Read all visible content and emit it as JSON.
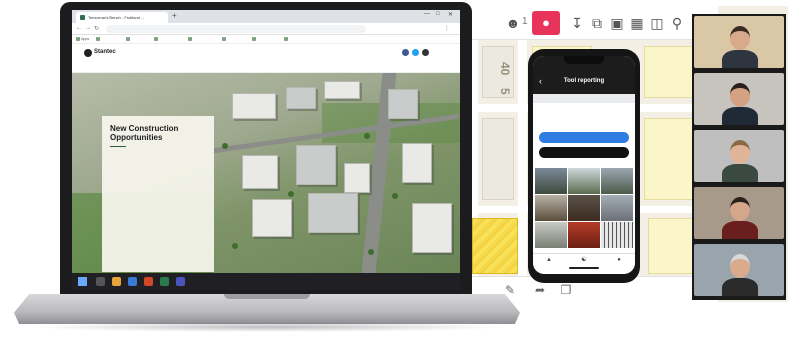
{
  "map_app": {
    "participant_count": "1",
    "record_icon": "record-icon",
    "toolbar_icons": [
      "download-icon",
      "layers-icon",
      "comment-icon",
      "table-icon",
      "panel-icon",
      "zoom-icon"
    ],
    "road_label_1": "40",
    "road_label_2": "5",
    "bottom_icons": [
      "pen-icon",
      "share-icon",
      "copy-icon"
    ]
  },
  "video_tiles": [
    {
      "name": "",
      "wall": "#d9c7a6",
      "skin": "#d8a98a",
      "hair": "#3a2a20",
      "shirt": "#2e3440"
    },
    {
      "name": "",
      "wall": "#c7c3bd",
      "skin": "#d4a283",
      "hair": "#2a1f1a",
      "shirt": "#1f2a36"
    },
    {
      "name": "",
      "wall": "#bfbfbf",
      "skin": "#e0b497",
      "hair": "#8a6a45",
      "shirt": "#3a4a40"
    },
    {
      "name": "",
      "wall": "#a89a8a",
      "skin": "#d6a68a",
      "hair": "#2b221c",
      "shirt": "#6a1e1e"
    },
    {
      "name": "",
      "wall": "#9aa4ad",
      "skin": "#d9ab8c",
      "hair": "#d8d8d8",
      "shirt": "#2b2b2b"
    }
  ],
  "browser": {
    "tab_title": "Tomorrow's Bench - Fruitland ...",
    "url": "",
    "bookmarks": [
      "Apps",
      "",
      "",
      "",
      "",
      "",
      "",
      ""
    ]
  },
  "website": {
    "logo": "Stantec",
    "tagline": "",
    "nav": [
      "",
      "",
      "",
      ""
    ],
    "card_title": "New Construction Opportunities",
    "card_body": "",
    "card_caption": ""
  },
  "taskbar": {
    "time": "",
    "date": ""
  },
  "phone": {
    "time": "",
    "title": "Tool reporting",
    "bar_text": "",
    "description": "",
    "button_primary": "",
    "button_secondary": "",
    "nav_icons": [
      "map-icon",
      "people-icon",
      "profile-icon"
    ]
  },
  "colors": {
    "brand": "#2b5e46",
    "record": "#e8335a",
    "phone_button": "#2f7de1"
  }
}
